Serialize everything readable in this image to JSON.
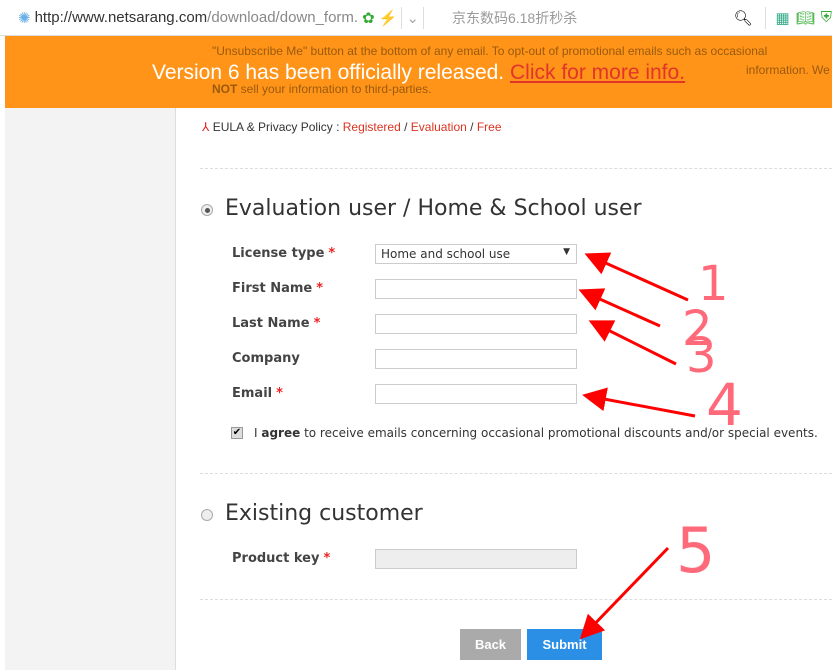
{
  "browser": {
    "url_host": "http://www.netsarang.com",
    "url_path": "/download/down_form.",
    "search_hint": "京东数码6.18折秒杀"
  },
  "behind_text": {
    "line1": "\"Unsubscribe Me\" button at the bottom of any email. To opt-out of promotional emails such as occasional",
    "line2": "information. We",
    "line3_bold": "NOT",
    "line3": " sell your information to third-parties."
  },
  "banner": {
    "text": "Version 6 has been officially released.",
    "link": "Click for more info."
  },
  "eula": {
    "label": "EULA & Privacy Policy : ",
    "registered": "Registered",
    "evaluation": "Evaluation",
    "free": "Free",
    "sep": " / "
  },
  "evaluation": {
    "title": "Evaluation user / Home & School user",
    "selected": true,
    "fields": {
      "license_type": "License type",
      "license_value": "Home and school use",
      "first_name": "First Name",
      "last_name": "Last Name",
      "company": "Company",
      "email": "Email"
    },
    "required": "*",
    "agree_prefix": "I ",
    "agree_bold": "agree",
    "agree_text": " to receive emails concerning occasional promotional discounts and/or special events.",
    "agree_checked": true
  },
  "existing": {
    "title": "Existing customer",
    "selected": false,
    "product_key": "Product key"
  },
  "buttons": {
    "back": "Back",
    "submit": "Submit"
  },
  "annotations": {
    "n1": "1",
    "n2": "2",
    "n3": "3",
    "n4": "4",
    "n5": "5",
    "color": "#ff0000"
  }
}
